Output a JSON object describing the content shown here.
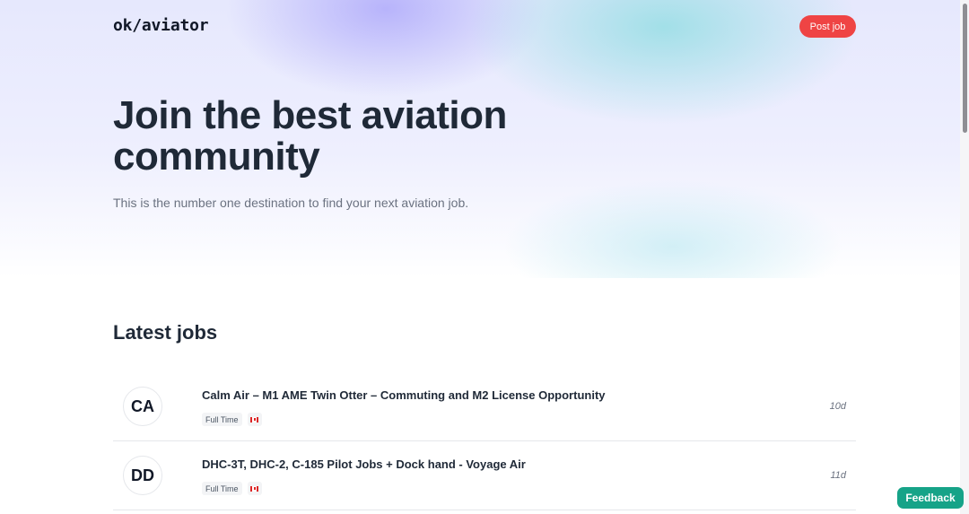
{
  "header": {
    "logo": "ok/aviator",
    "post_job_label": "Post job"
  },
  "hero": {
    "headline_line1": "Join the best aviation",
    "headline_line2": "community",
    "subtitle": "This is the number one destination to find your next aviation job."
  },
  "jobs_section": {
    "title": "Latest jobs",
    "jobs": [
      {
        "initials": "CA",
        "title": "Calm Air – M1 AME Twin Otter – Commuting and M2 License Opportunity",
        "type": "Full Time",
        "country_flag": "canada-flag-icon",
        "age": "10d"
      },
      {
        "initials": "DD",
        "title": "DHC-3T, DHC-2, C-185 Pilot Jobs + Dock hand - Voyage Air",
        "type": "Full Time",
        "country_flag": "canada-flag-icon",
        "age": "11d"
      }
    ]
  },
  "feedback_label": "Feedback",
  "colors": {
    "accent_red": "#ef4444",
    "feedback_green": "#16a388",
    "text_dark": "#1f2937"
  }
}
